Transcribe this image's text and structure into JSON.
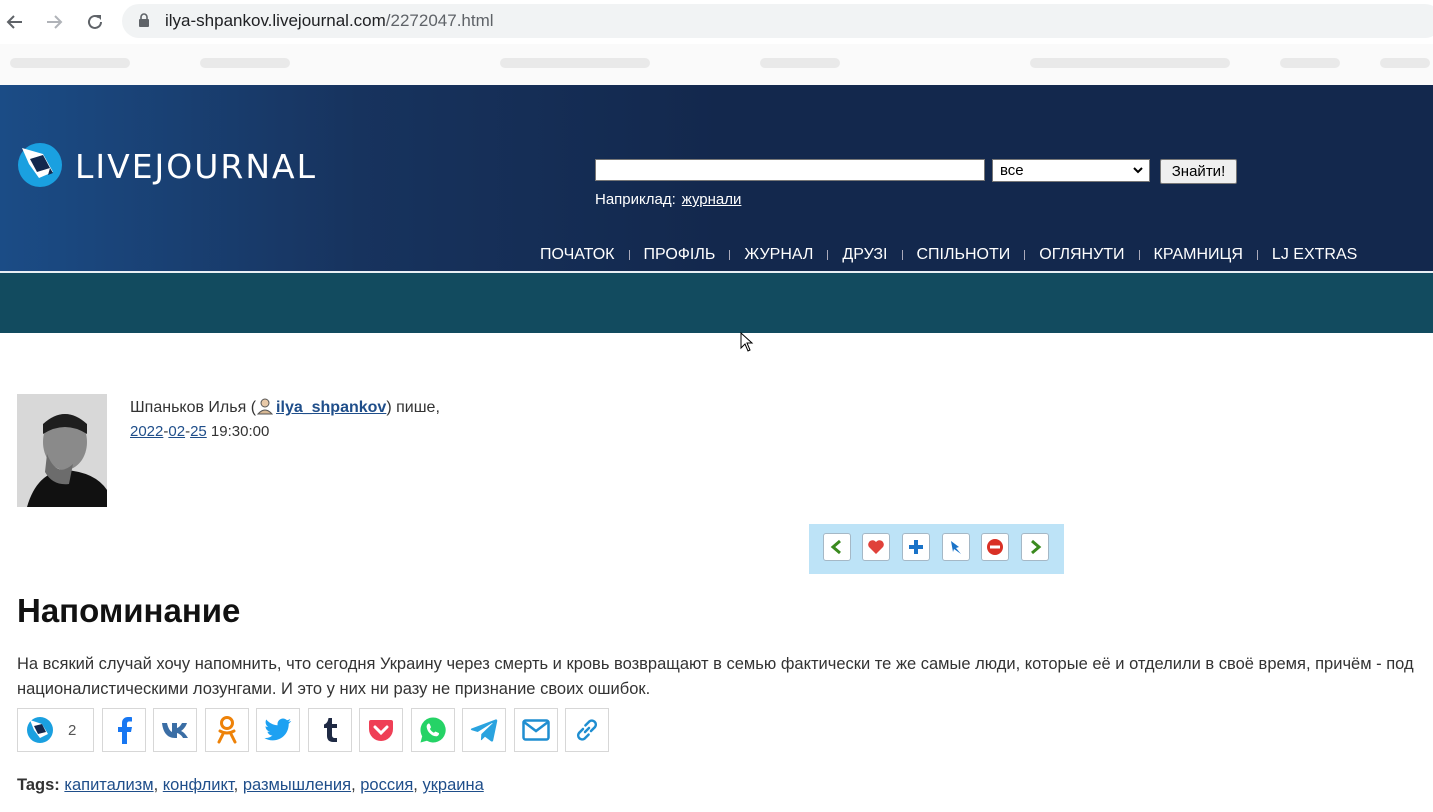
{
  "browser": {
    "back_icon": "arrow-left-icon",
    "forward_icon": "arrow-right-icon",
    "reload_icon": "reload-icon",
    "url_host": "ilya-shpankov.livejournal.com",
    "url_path": "/2272047.html"
  },
  "header": {
    "logo_text": "LIVEJOURNAL",
    "search_placeholder": "",
    "search_scope": "все",
    "search_button": "Знайти!",
    "example_label": "Наприклад:",
    "example_link": "журнали",
    "menu": [
      "ПОЧАТОК",
      "ПРОФІЛЬ",
      "ЖУРНАЛ",
      "ДРУЗІ",
      "СПІЛЬНОТИ",
      "ОГЛЯНУТИ",
      "КРАМНИЦЯ",
      "LJ EXTRAS"
    ]
  },
  "post": {
    "author_name": "Шпаньков Илья",
    "username": "ilya_shpankov",
    "writes": "пише,",
    "date_year": "2022",
    "date_month": "02",
    "date_day": "25",
    "time": "19:30:00",
    "title": "Напоминание",
    "body": "На всякий случай хочу напомнить, что сегодня Украину через смерть и кровь возвращают в семью фактически те же самые люди, которые её и отделили в своё время, причём - под националистическими лозунгами. И это у них ни разу не признание своих ошибок.",
    "share_count": "2",
    "tags_label": "Tags:",
    "tags": [
      "капитализм",
      "конфликт",
      "размышления",
      "россия",
      "украина"
    ]
  },
  "toolbar_icons": [
    "prev-arrow-icon",
    "heart-icon",
    "plus-icon",
    "pin-icon",
    "stop-icon",
    "next-arrow-icon"
  ],
  "share_icons": [
    "livejournal-icon",
    "facebook-icon",
    "vk-icon",
    "odnoklassniki-icon",
    "twitter-icon",
    "tumblr-icon",
    "pocket-icon",
    "whatsapp-icon",
    "telegram-icon",
    "email-icon",
    "link-icon"
  ],
  "colors": {
    "header_dark": "#13284d",
    "header_light": "#1b4c86",
    "teal_bar": "#124b5f",
    "link": "#1f4e8a",
    "toolbar_bg": "#bde3f7"
  }
}
